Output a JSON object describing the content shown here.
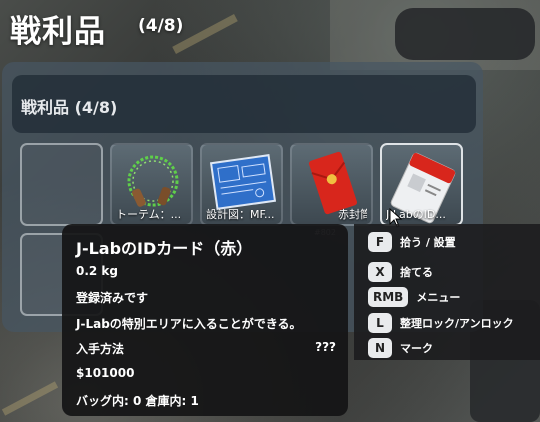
{
  "title": {
    "main": "戦利品",
    "count": "(4/8)"
  },
  "panel": {
    "header": "戦利品 (4/8)"
  },
  "slots": [
    {
      "label": ""
    },
    {
      "label": "トーテム：..."
    },
    {
      "label": "設計図：MF..."
    },
    {
      "label": "赤封筒"
    },
    {
      "label": "J-LabのID..."
    },
    {
      "label": ""
    }
  ],
  "slot_id_tag": "#802",
  "tooltip": {
    "name": "J-LabのIDカード（赤）",
    "weight": "0.2 kg",
    "status": "登録済みです",
    "description": "J-Labの特別エリアに入ることができる。",
    "source_label": "入手方法",
    "source_value": "???",
    "price": "$101000",
    "storage": "バッグ内: 0 倉庫内: 1"
  },
  "actions": [
    {
      "key": "F",
      "label": "拾う / 設置"
    },
    {
      "key": "X",
      "label": "捨てる"
    },
    {
      "key": "RMB",
      "label": "メニュー"
    },
    {
      "key": "L",
      "label": "整理ロック/アンロック"
    },
    {
      "key": "N",
      "label": "マーク"
    }
  ],
  "colors": {
    "panel": "#46566280",
    "tooltip": "#141416",
    "key_bg": "#e9ebed",
    "envelope_red": "#d8261c"
  }
}
